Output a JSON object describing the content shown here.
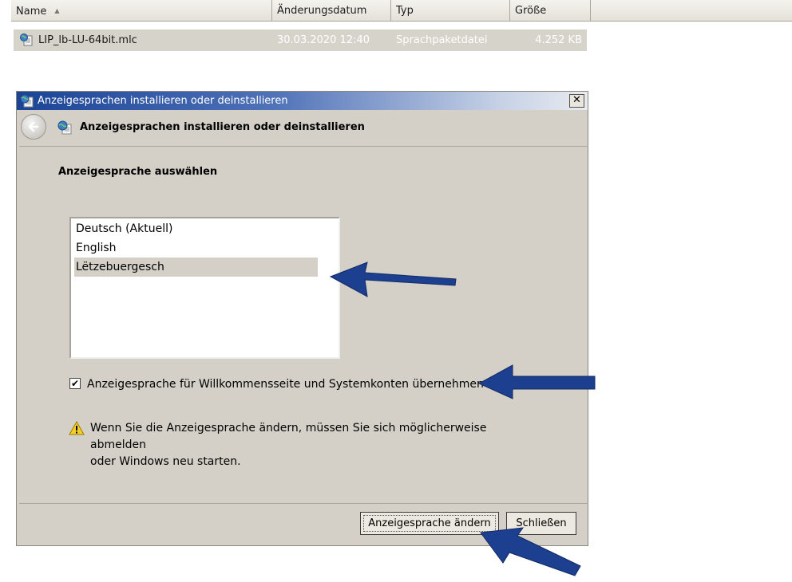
{
  "explorer": {
    "columns": [
      "Name",
      "Änderungsdatum",
      "Typ",
      "Größe"
    ],
    "file": {
      "name": "LIP_lb-LU-64bit.mlc",
      "modified": "30.03.2020 12:40",
      "type": "Sprachpaketdatei",
      "size": "4.252 KB"
    }
  },
  "dialog": {
    "window_title": "Anzeigesprachen installieren oder deinstallieren",
    "nav_title": "Anzeigesprachen installieren oder deinstallieren",
    "section_title": "Anzeigesprache auswählen",
    "languages": [
      "Deutsch (Aktuell)",
      "English",
      "Lëtzebuergesch"
    ],
    "selected_language": "Lëtzebuergesch",
    "checkbox_label": "Anzeigesprache für Willkommensseite und Systemkonten übernehmen",
    "checkbox_checked": true,
    "warning_line1": "Wenn Sie die Anzeigesprache ändern, müssen Sie sich möglicherweise abmelden",
    "warning_line2": "oder Windows neu starten.",
    "btn_change": "Anzeigesprache ändern",
    "btn_close": "Schließen"
  },
  "icons": {
    "sort": "sort-ascending-icon",
    "file": "language-pack-file-icon",
    "window": "language-globe-icon",
    "back": "back-arrow-icon",
    "close": "close-icon",
    "warning": "warning-icon"
  },
  "colors": {
    "dialog_bg": "#d4d0c8",
    "title_gradient_start": "#1b4496",
    "annotation_arrow": "#1c3f8f"
  }
}
